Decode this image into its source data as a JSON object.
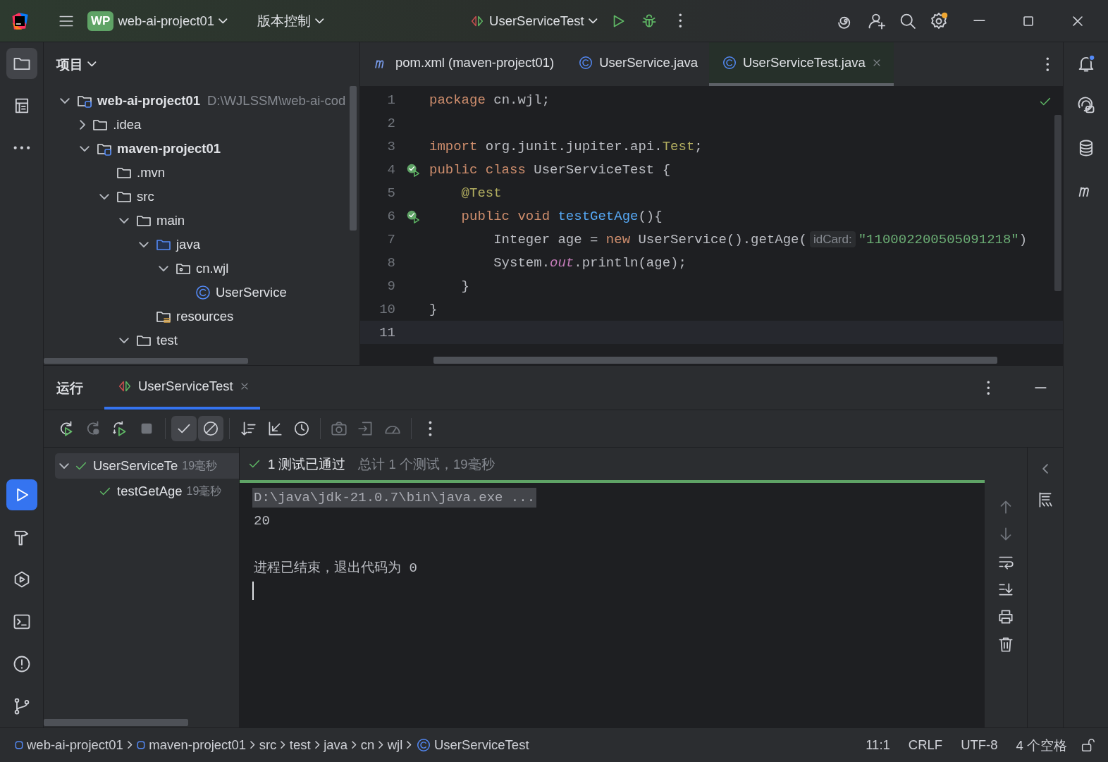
{
  "title_bar": {
    "project_badge": "WP",
    "project": "web-ai-project01",
    "vcs": "版本控制",
    "run_config": "UserServiceTest"
  },
  "left_toolbar": {
    "top": [
      {
        "kind": "folder",
        "selected": true
      },
      {
        "kind": "structure",
        "selected": false
      },
      {
        "kind": "more",
        "selected": false
      }
    ],
    "bottom": [
      {
        "kind": "run",
        "selected": true
      },
      {
        "kind": "build",
        "selected": false
      },
      {
        "kind": "services",
        "selected": false
      },
      {
        "kind": "terminal",
        "selected": false
      },
      {
        "kind": "problems",
        "selected": false
      },
      {
        "kind": "git",
        "selected": false
      }
    ]
  },
  "project_panel": {
    "title": "项目",
    "tree": [
      {
        "kind": "module",
        "label": "web-ai-project01",
        "path": "D:\\WJLSSM\\web-ai-cod",
        "expanded": true,
        "children": [
          {
            "kind": "folder",
            "label": ".idea",
            "expanded": false
          },
          {
            "kind": "module",
            "label": "maven-project01",
            "expanded": true,
            "children": [
              {
                "kind": "folder",
                "label": ".mvn"
              },
              {
                "kind": "folder",
                "label": "src",
                "expanded": true,
                "children": [
                  {
                    "kind": "folder",
                    "label": "main",
                    "expanded": true,
                    "children": [
                      {
                        "kind": "source",
                        "label": "java",
                        "expanded": true,
                        "children": [
                          {
                            "kind": "package",
                            "label": "cn.wjl",
                            "expanded": true,
                            "children": [
                              {
                                "kind": "class",
                                "label": "UserService"
                              }
                            ]
                          }
                        ]
                      },
                      {
                        "kind": "resources",
                        "label": "resources"
                      }
                    ]
                  },
                  {
                    "kind": "folder",
                    "label": "test",
                    "expanded": true
                  }
                ]
              }
            ]
          }
        ]
      }
    ]
  },
  "editor": {
    "tabs": [
      {
        "kind": "maven",
        "label": "pom.xml (maven-project01)",
        "selected": false
      },
      {
        "kind": "class",
        "label": "UserService.java",
        "selected": false
      },
      {
        "kind": "class",
        "label": "UserServiceTest.java",
        "selected": true
      }
    ],
    "lines": [
      {
        "number": "1",
        "tokens": [
          {
            "kind": "keyword",
            "s": "package"
          },
          {
            "kind": "plain",
            "s": " cn.wjl;"
          }
        ]
      },
      {
        "number": "2"
      },
      {
        "number": "3",
        "tokens": [
          {
            "kind": "keyword",
            "s": "import"
          },
          {
            "kind": "plain",
            "s": " org.junit.jupiter.api."
          },
          {
            "kind": "annotation",
            "s": "Test"
          },
          {
            "kind": "plain",
            "s": ";"
          }
        ]
      },
      {
        "number": "4",
        "test_passed": true,
        "tokens": [
          {
            "kind": "keyword",
            "s": "public class"
          },
          {
            "kind": "plain",
            "s": " UserServiceTest {"
          }
        ]
      },
      {
        "number": "5",
        "tokens": [
          {
            "kind": "annotation",
            "s": "    @Test"
          }
        ]
      },
      {
        "number": "6",
        "test_passed": true,
        "tokens": [
          {
            "kind": "keyword",
            "s": "    public void"
          },
          {
            "kind": "function",
            "s": " testGetAge"
          },
          {
            "kind": "plain",
            "s": "(){"
          }
        ]
      },
      {
        "number": "7",
        "tokens": [
          {
            "kind": "plain",
            "s": "        Integer age = "
          },
          {
            "kind": "keyword",
            "s": "new"
          },
          {
            "kind": "plain",
            "s": " UserService().getAge("
          },
          {
            "kind": "hint",
            "s": "idCard:"
          },
          {
            "kind": "string",
            "s": "\"110002200505091218\""
          },
          {
            "kind": "plain",
            "s": ")"
          }
        ]
      },
      {
        "number": "8",
        "tokens": [
          {
            "kind": "plain",
            "s": "        System."
          },
          {
            "kind": "field",
            "s": "out"
          },
          {
            "kind": "plain",
            "s": ".println(age);"
          }
        ]
      },
      {
        "number": "9",
        "tokens": [
          {
            "kind": "plain",
            "s": "    }"
          }
        ]
      },
      {
        "number": "10",
        "tokens": [
          {
            "kind": "plain",
            "s": "}"
          }
        ]
      },
      {
        "number": "11",
        "current": true
      }
    ]
  },
  "run_panel": {
    "title": "运行",
    "tabs": [
      {
        "label": "UserServiceTest",
        "selected": true
      }
    ],
    "toolbar": [
      {
        "kind": "rerun",
        "disabled": false,
        "selected": false
      },
      {
        "kind": "rerun-failed",
        "disabled": true,
        "selected": false
      },
      {
        "kind": "toggle-rerun",
        "disabled": false,
        "selected": false
      },
      {
        "kind": "stop",
        "disabled": true,
        "selected": false
      },
      {
        "kind": "show-passed",
        "disabled": false,
        "selected": true
      },
      {
        "kind": "show-ignored",
        "disabled": false,
        "selected": true
      },
      {
        "kind": "sort",
        "disabled": false,
        "selected": false
      },
      {
        "kind": "collapse",
        "disabled": false,
        "selected": false
      },
      {
        "kind": "history",
        "disabled": false,
        "selected": false
      },
      {
        "kind": "camera",
        "disabled": true,
        "selected": false
      },
      {
        "kind": "export",
        "disabled": true,
        "selected": false
      },
      {
        "kind": "gauge",
        "disabled": true,
        "selected": false
      },
      {
        "kind": "more",
        "disabled": false,
        "selected": false
      }
    ],
    "tests": [
      {
        "label": "UserServiceTe",
        "time": "19毫秒",
        "passed": true,
        "selected": true,
        "expanded": true,
        "children": [
          {
            "label": "testGetAge",
            "time": "19毫秒",
            "passed": true,
            "selected": false
          }
        ]
      }
    ],
    "summary": {
      "passed": true,
      "status": "1 测试已通过",
      "detail": "总计 1 个测试，19毫秒"
    },
    "console": [
      {
        "kind": "command",
        "text": "D:\\java\\jdk-21.0.7\\bin\\java.exe ..."
      },
      {
        "kind": "output",
        "text": "20"
      },
      {
        "kind": "exit",
        "text": "进程已结束，退出代码为 0"
      }
    ],
    "side_tools": [
      {
        "kind": "up",
        "disabled": true
      },
      {
        "kind": "down",
        "disabled": true
      },
      {
        "kind": "wrap",
        "disabled": false
      },
      {
        "kind": "scroll-end",
        "disabled": false
      },
      {
        "kind": "print",
        "disabled": false
      },
      {
        "kind": "trash",
        "disabled": false
      }
    ]
  },
  "status_bar": {
    "breadcrumbs": [
      {
        "kind": "module",
        "label": "web-ai-project01"
      },
      {
        "kind": "module",
        "label": "maven-project01"
      },
      {
        "kind": "folder",
        "label": "src"
      },
      {
        "kind": "folder",
        "label": "test"
      },
      {
        "kind": "folder",
        "label": "java"
      },
      {
        "kind": "folder",
        "label": "cn"
      },
      {
        "kind": "folder",
        "label": "wjl"
      },
      {
        "kind": "class",
        "label": "UserServiceTest"
      }
    ],
    "position": "11:1",
    "line_ending": "CRLF",
    "encoding": "UTF-8",
    "indent": "4 个空格"
  }
}
